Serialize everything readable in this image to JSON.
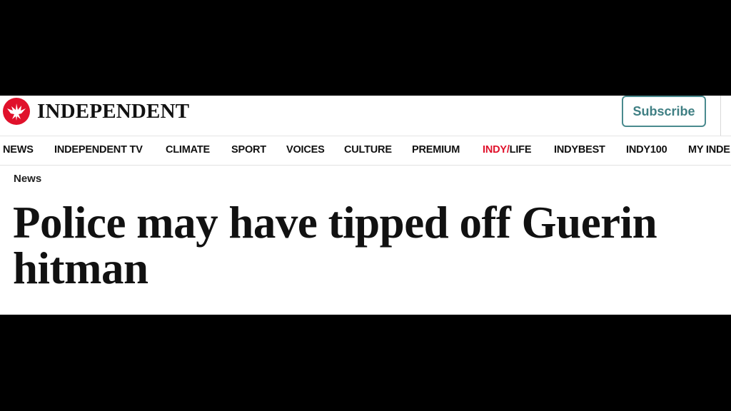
{
  "brand": {
    "name": "INDEPENDENT",
    "logo_icon": "eagle-icon",
    "logo_color": "#e0112b"
  },
  "header": {
    "subscribe_label": "Subscribe",
    "accent": "#3f7f83"
  },
  "nav": {
    "items": [
      {
        "label": "NEWS"
      },
      {
        "label": "INDEPENDENT TV"
      },
      {
        "label": "CLIMATE"
      },
      {
        "label": "SPORT"
      },
      {
        "label": "VOICES"
      },
      {
        "label": "CULTURE"
      },
      {
        "label": "PREMIUM"
      },
      {
        "label_prefix": "INDY/",
        "label_suffix": "LIFE"
      },
      {
        "label": "INDYBEST"
      },
      {
        "label": "INDY100"
      },
      {
        "label": "MY INDE"
      }
    ]
  },
  "article": {
    "section": "News",
    "headline": "Police may have tipped off Guerin hitman"
  }
}
